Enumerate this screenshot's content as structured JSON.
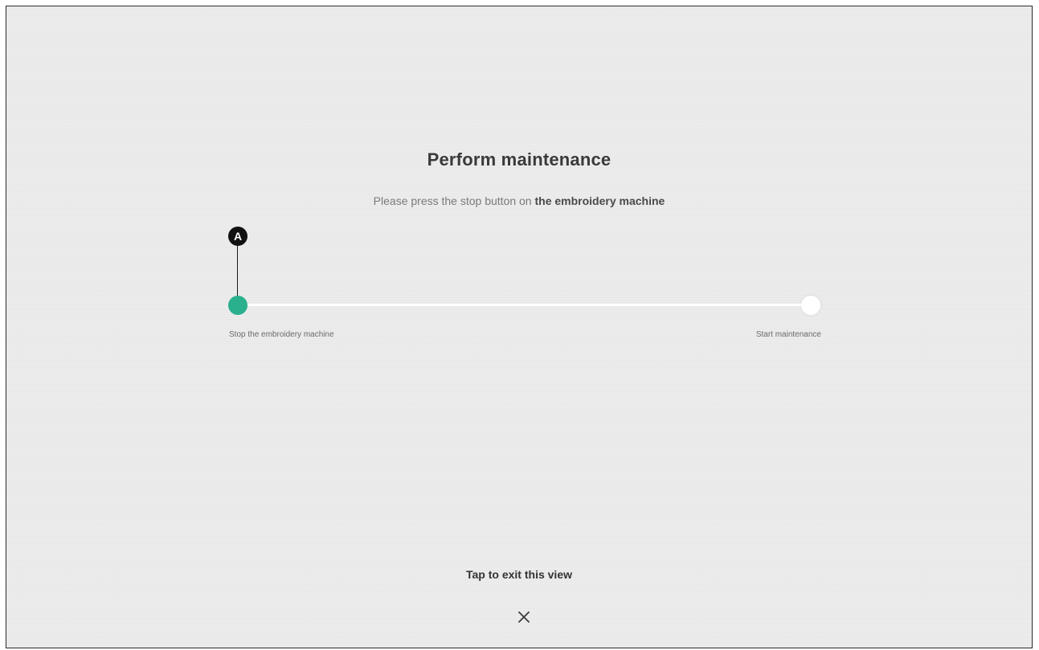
{
  "dialog": {
    "title": "Perform maintenance",
    "instruction_prefix": "Please press the stop button on ",
    "instruction_emphasis": "the embroidery machine"
  },
  "progress": {
    "steps": [
      {
        "label": "Stop the embroidery machine",
        "state": "active"
      },
      {
        "label": "Start maintenance",
        "state": "pending"
      }
    ],
    "current_step": 1,
    "active_color": "#2bb08e",
    "pending_color": "#ffffff"
  },
  "callout": {
    "label": "A"
  },
  "exit": {
    "label": "Tap to exit this view",
    "icon": "close-icon"
  }
}
